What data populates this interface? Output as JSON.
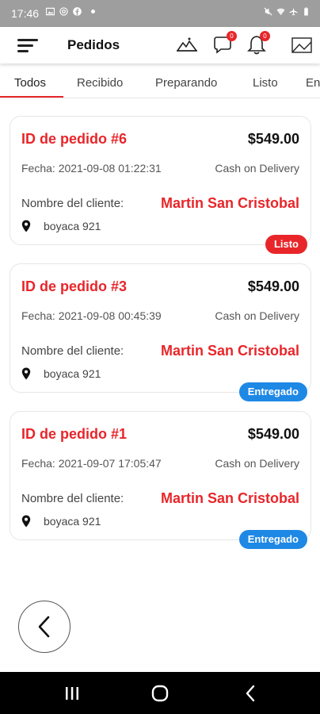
{
  "status_bar": {
    "time": "17:46",
    "icons_left": [
      "image-icon",
      "at-icon",
      "facebook-icon"
    ],
    "icons_right": [
      "mute-icon",
      "wifi-icon",
      "airplane-icon",
      "battery-icon"
    ]
  },
  "app_bar": {
    "title": "Pedidos",
    "messages_badge": "0",
    "notifications_badge": "0"
  },
  "tabs": [
    {
      "label": "Todos",
      "active": true
    },
    {
      "label": "Recibido",
      "active": false
    },
    {
      "label": "Preparando",
      "active": false
    },
    {
      "label": "Listo",
      "active": false
    },
    {
      "label": "En",
      "active": false
    }
  ],
  "orders": [
    {
      "id_label": "ID de pedido #6",
      "amount": "$549.00",
      "date": "Fecha: 2021-09-08 01:22:31",
      "payment": "Cash on Delivery",
      "client_label": "Nombre del cliente:",
      "client_name": "Martin San Cristobal",
      "address": "boyaca 921",
      "status": "Listo",
      "status_color": "#e8262a"
    },
    {
      "id_label": "ID de pedido #3",
      "amount": "$549.00",
      "date": "Fecha: 2021-09-08 00:45:39",
      "payment": "Cash on Delivery",
      "client_label": "Nombre del cliente:",
      "client_name": "Martin San Cristobal",
      "address": "boyaca 921",
      "status": "Entregado",
      "status_color": "#1e88e5"
    },
    {
      "id_label": "ID de pedido #1",
      "amount": "$549.00",
      "date": "Fecha: 2021-09-07 17:05:47",
      "payment": "Cash on Delivery",
      "client_label": "Nombre del cliente:",
      "client_name": "Martin San Cristobal",
      "address": "boyaca 921",
      "status": "Entregado",
      "status_color": "#1e88e5"
    }
  ],
  "colors": {
    "accent": "#e8262a",
    "delivered": "#1e88e5"
  }
}
